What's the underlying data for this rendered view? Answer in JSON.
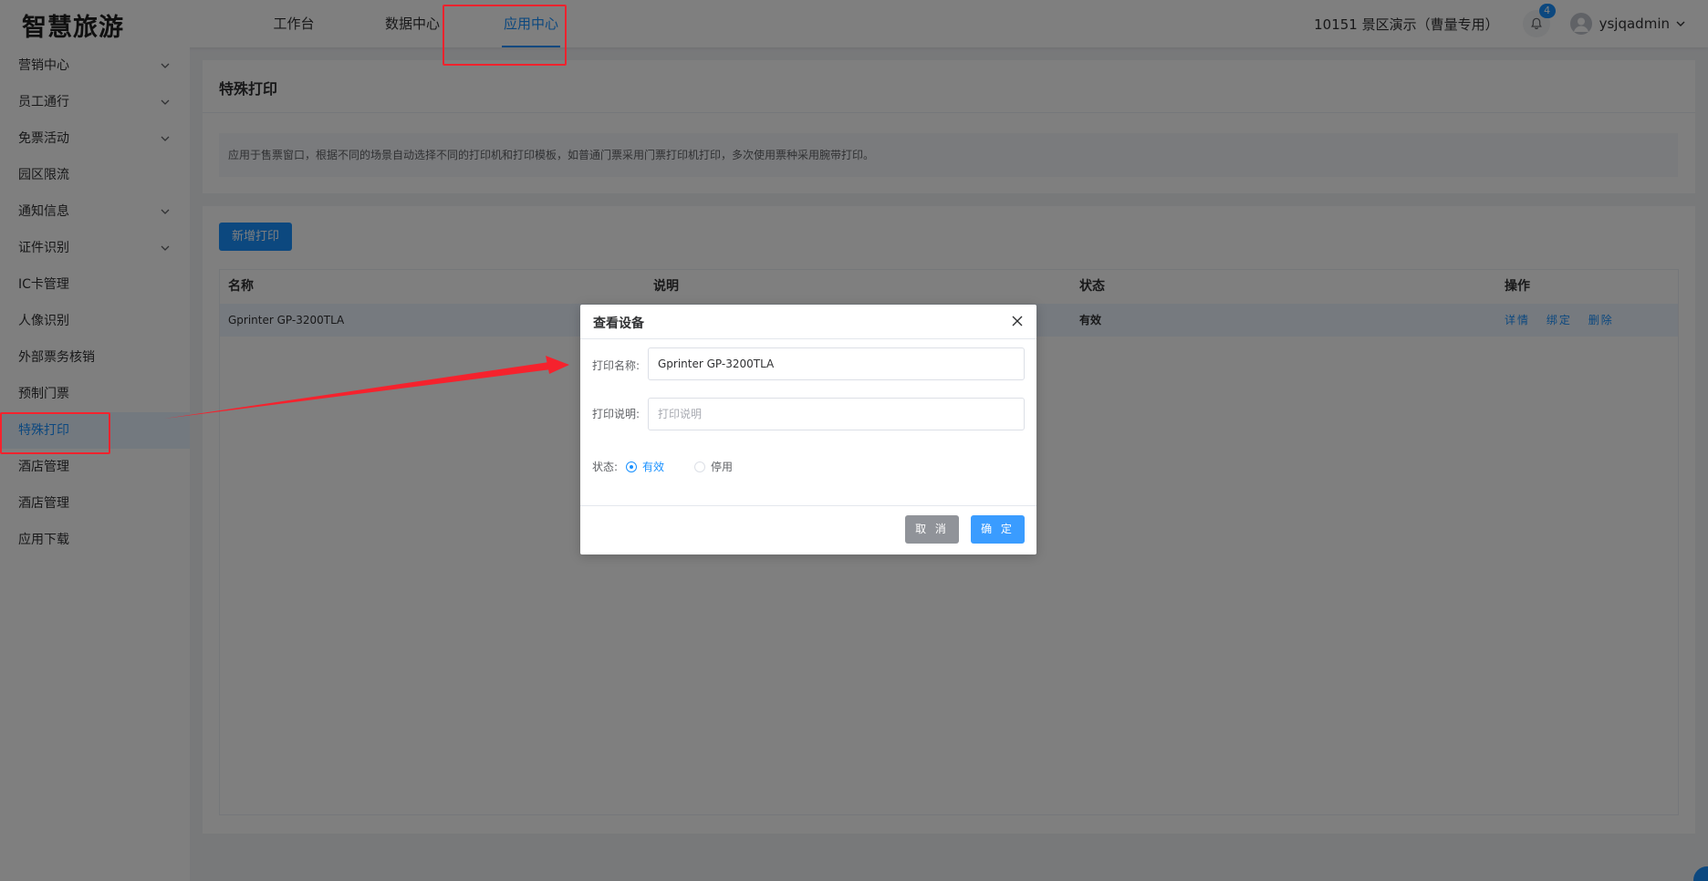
{
  "header": {
    "logo": "智慧旅游",
    "nav": [
      {
        "label": "工作台"
      },
      {
        "label": "数据中心"
      },
      {
        "label": "应用中心"
      }
    ],
    "scenic": "10151 景区演示（曹量专用）",
    "notification_count": "4",
    "username": "ysjqadmin"
  },
  "sidebar": {
    "items": [
      {
        "label": "营销中心",
        "expandable": true
      },
      {
        "label": "员工通行",
        "expandable": true
      },
      {
        "label": "免票活动",
        "expandable": true
      },
      {
        "label": "园区限流",
        "expandable": false
      },
      {
        "label": "通知信息",
        "expandable": true
      },
      {
        "label": "证件识别",
        "expandable": true
      },
      {
        "label": "IC卡管理",
        "expandable": false
      },
      {
        "label": "人像识别",
        "expandable": false
      },
      {
        "label": "外部票务核销",
        "expandable": false
      },
      {
        "label": "预制门票",
        "expandable": false
      },
      {
        "label": "特殊打印",
        "expandable": false,
        "active": true
      },
      {
        "label": "酒店管理",
        "expandable": false
      },
      {
        "label": "酒店管理",
        "expandable": false
      },
      {
        "label": "应用下载",
        "expandable": false
      }
    ]
  },
  "page": {
    "title": "特殊打印",
    "description": "应用于售票窗口，根据不同的场景自动选择不同的打印机和打印模板，如普通门票采用门票打印机打印，多次使用票种采用腕带打印。",
    "add_button": "新增打印"
  },
  "table": {
    "headers": {
      "name": "名称",
      "desc": "说明",
      "status": "状态",
      "ops": "操作"
    },
    "rows": [
      {
        "name": "Gprinter GP-3200TLA",
        "desc": "",
        "status": "有效",
        "ops": [
          "详情",
          "绑定",
          "删除"
        ]
      }
    ]
  },
  "dialog": {
    "title": "查看设备",
    "name_label": "打印名称:",
    "name_value": "Gprinter GP-3200TLA",
    "desc_label": "打印说明:",
    "desc_placeholder": "打印说明",
    "status_label": "状态:",
    "status_options": [
      "有效",
      "停用"
    ],
    "status_selected": "有效",
    "cancel": "取 消",
    "ok": "确 定"
  },
  "colors": {
    "accent": "#1890ff",
    "annotation": "#f5222d"
  }
}
